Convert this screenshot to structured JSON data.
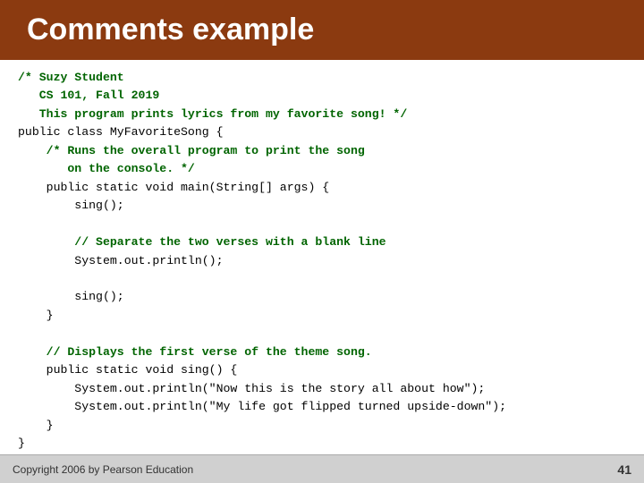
{
  "header": {
    "title": "Comments example",
    "bg_color": "#8B3A10"
  },
  "code": {
    "lines": [
      {
        "type": "comment",
        "text": "/* Suzy Student"
      },
      {
        "type": "comment",
        "text": "   CS 101, Fall 2019"
      },
      {
        "type": "comment",
        "text": "   This program prints lyrics from my favorite song! */"
      },
      {
        "type": "normal",
        "text": "public class MyFavoriteSong {"
      },
      {
        "type": "comment",
        "text": "    /* Runs the overall program to print the song"
      },
      {
        "type": "comment",
        "text": "       on the console. */"
      },
      {
        "type": "normal",
        "text": "    public static void main(String[] args) {"
      },
      {
        "type": "normal",
        "text": "        sing();"
      },
      {
        "type": "normal",
        "text": ""
      },
      {
        "type": "comment",
        "text": "        // Separate the two verses with a blank line"
      },
      {
        "type": "normal",
        "text": "        System.out.println();"
      },
      {
        "type": "normal",
        "text": ""
      },
      {
        "type": "normal",
        "text": "        sing();"
      },
      {
        "type": "normal",
        "text": "    }"
      },
      {
        "type": "normal",
        "text": ""
      },
      {
        "type": "comment",
        "text": "    // Displays the first verse of the theme song."
      },
      {
        "type": "normal",
        "text": "    public static void sing() {"
      },
      {
        "type": "normal",
        "text": "        System.out.println(\"Now this is the story all about how\");"
      },
      {
        "type": "normal",
        "text": "        System.out.println(\"My life got flipped turned upside-down\");"
      },
      {
        "type": "normal",
        "text": "    }"
      },
      {
        "type": "normal",
        "text": "}"
      }
    ]
  },
  "footer": {
    "copyright": "Copyright 2006 by Pearson Education",
    "page_number": "41"
  }
}
